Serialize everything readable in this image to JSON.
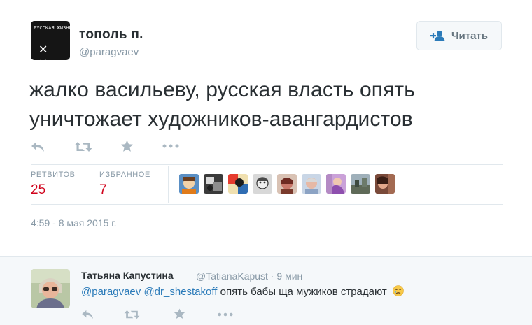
{
  "tweet": {
    "author": {
      "name": "тополь п.",
      "handle": "@paragvaev",
      "avatar": {
        "label_text": "РУССКАЯ ЖИЗНЬ",
        "marks": "✕ ✕"
      }
    },
    "follow_button": {
      "label": "Читать",
      "icon": "add-user-icon"
    },
    "text": "жалко васильеву, русская власть опять уничтожает художников-авангардистов",
    "actions": [
      {
        "name": "reply",
        "icon": "reply-icon"
      },
      {
        "name": "retweet",
        "icon": "retweet-icon"
      },
      {
        "name": "favorite",
        "icon": "star-icon"
      },
      {
        "name": "more",
        "icon": "more-icon"
      }
    ],
    "stats": {
      "retweets_label": "РЕТВИТОВ",
      "retweets_value": "25",
      "favorites_label": "ИЗБРАННОЕ",
      "favorites_value": "7"
    },
    "favorited_by_count": 9,
    "timestamp": "4:59 - 8 мая 2015 г."
  },
  "reply": {
    "name": "Татьяна Капустина",
    "handle": "@TatianaKapust",
    "separator": "·",
    "time": "9 мин",
    "mentions": [
      "@paragvaev",
      "@dr_shestakoff"
    ],
    "text": "опять бабы ща мужиков страдают",
    "emoji": "crying-face-emoji",
    "actions": [
      {
        "name": "reply",
        "icon": "reply-icon"
      },
      {
        "name": "retweet",
        "icon": "retweet-icon"
      },
      {
        "name": "favorite",
        "icon": "star-icon"
      },
      {
        "name": "more",
        "icon": "more-icon"
      }
    ]
  },
  "colors": {
    "stat_value": "#d0021b",
    "mention": "#2b7bb9",
    "muted": "#8899a6",
    "icon": "#aab8c2"
  }
}
